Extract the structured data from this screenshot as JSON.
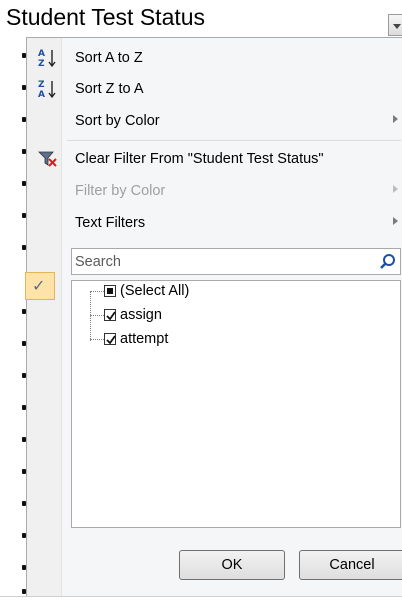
{
  "header": {
    "title": "Student Test Status"
  },
  "menu": {
    "items": [
      {
        "label": "Sort A to Z",
        "icon": "sort-a-to-z-icon",
        "disabled": false,
        "submenu": false
      },
      {
        "label": "Sort Z to A",
        "icon": "sort-z-to-a-icon",
        "disabled": false,
        "submenu": false
      },
      {
        "label": "Sort by Color",
        "icon": "",
        "disabled": false,
        "submenu": true
      },
      {
        "label": "Clear Filter From \"Student Test Status\"",
        "icon": "clear-filter-icon",
        "disabled": false,
        "submenu": false
      },
      {
        "label": "Filter by Color",
        "icon": "",
        "disabled": true,
        "submenu": true
      },
      {
        "label": "Text Filters",
        "icon": "",
        "disabled": false,
        "submenu": true
      }
    ],
    "search": {
      "placeholder": "Search"
    },
    "values": [
      {
        "label": "(Select All)",
        "state": "indeterminate"
      },
      {
        "label": "assign",
        "state": "checked"
      },
      {
        "label": "attempt",
        "state": "checked"
      }
    ],
    "ok_label": "OK",
    "cancel_label": "Cancel"
  },
  "colors": {
    "highlight": "#fde3a7",
    "menu_bg": "#f5f6f7",
    "button_border": "#707070"
  }
}
